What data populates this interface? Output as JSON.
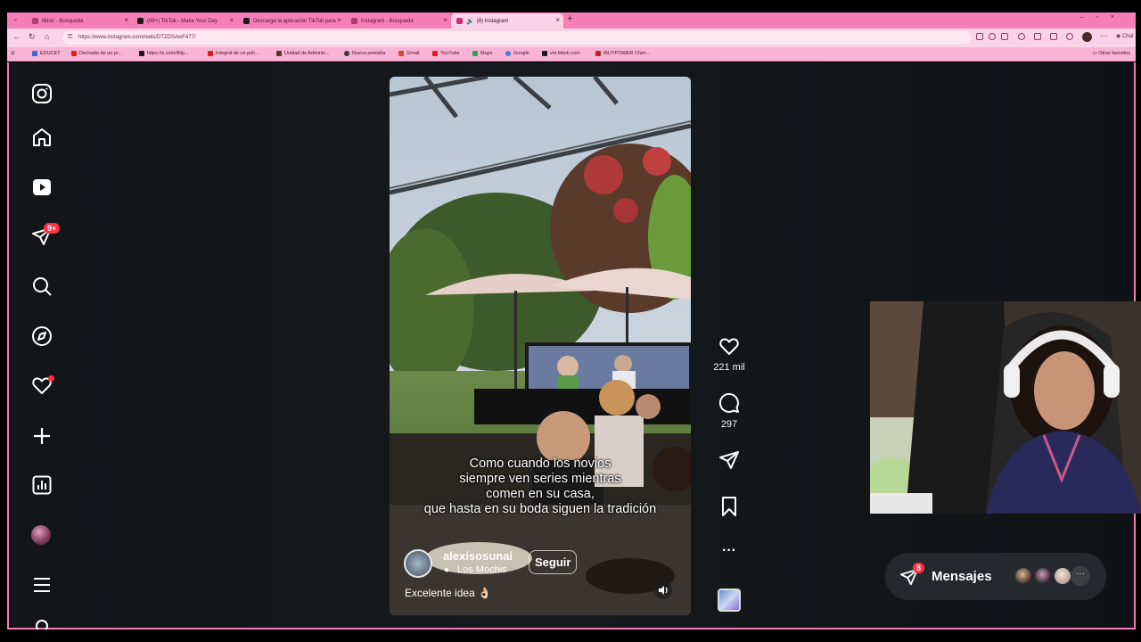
{
  "browser": {
    "tabs": [
      {
        "label": "tiktok - Búsqueda",
        "color": "#7a2a5a"
      },
      {
        "label": "(99+) TikTok - Make Your Day",
        "color": "#1a1a1a"
      },
      {
        "label": "Descarga la aplicación TikTok para",
        "color": "#1a1a1a"
      },
      {
        "label": "instagram - Búsqueda",
        "color": "#7a2a5a"
      },
      {
        "label": "(8) Instagram",
        "color": "#d02a7a"
      }
    ],
    "new_tab": "+",
    "url": "https://www.instagram.com/reels/DTZDSAwF477/",
    "chat_label": "Chat",
    "bookmarks": [
      {
        "label": "EDUCET",
        "color": "#3a6ad8"
      },
      {
        "label": "Derivado de un pr...",
        "color": "#e02020"
      },
      {
        "label": "https://x.com/Allp...",
        "color": "#1a1a1a"
      },
      {
        "label": "Integral de un poli...",
        "color": "#e02020"
      },
      {
        "label": "Unidad de Adminis...",
        "color": "#5a3a1a"
      },
      {
        "label": "Nueva pestaña",
        "color": "#3a3a3a"
      },
      {
        "label": "Gmail",
        "color": "#e04030"
      },
      {
        "label": "YouTube",
        "color": "#e02020"
      },
      {
        "label": "Maps",
        "color": "#30a050"
      },
      {
        "label": "Google",
        "color": "#4080e0"
      },
      {
        "label": "vm.tiktok.com",
        "color": "#1a1a1a"
      },
      {
        "label": "iBUYPOWER Chim...",
        "color": "#c02020"
      }
    ],
    "otros_favoritos": "Otros favoritos"
  },
  "sidebar": {
    "items": [
      {
        "icon": "instagram-logo-icon"
      },
      {
        "icon": "home-icon"
      },
      {
        "icon": "reels-icon"
      },
      {
        "icon": "messages-icon",
        "badge": "9+"
      },
      {
        "icon": "search-icon"
      },
      {
        "icon": "explore-icon"
      },
      {
        "icon": "notifications-icon"
      },
      {
        "icon": "create-icon"
      },
      {
        "icon": "dashboard-icon"
      },
      {
        "icon": "profile-avatar"
      },
      {
        "icon": "menu-icon"
      }
    ]
  },
  "reel": {
    "caption_lines": [
      "Como cuando los novios",
      "siempre ven series mientras",
      "comen en su casa,",
      "que hasta en su boda siguen la tradición"
    ],
    "author": "alexisosunai",
    "location": "Los Mochis",
    "follow_label": "Seguir",
    "description": "Excelente idea 👌🏻"
  },
  "actions": {
    "likes": "221 mil",
    "comments": "297"
  },
  "messages_bar": {
    "label": "Mensajes",
    "badge": "8",
    "more": "···"
  },
  "colors": {
    "chrome_pink": "#f47fb7",
    "badge_red": "#ff3040",
    "page_bg": "#131619"
  }
}
